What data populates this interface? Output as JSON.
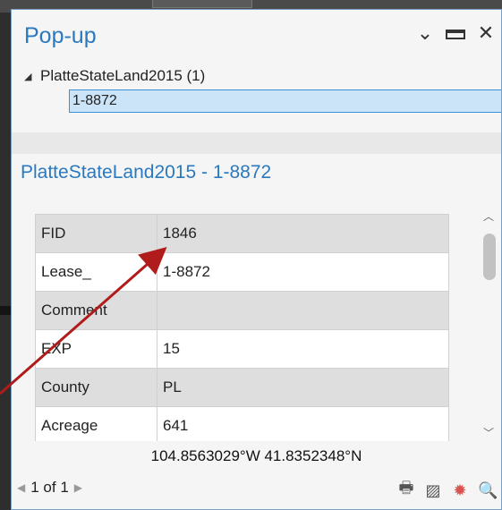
{
  "window": {
    "title": "Pop-up",
    "dropdown_icon": "⌄",
    "maximize_icon": "maximize-icon",
    "close_icon": "✕"
  },
  "tree": {
    "layer_label": "PlatteStateLand2015 (1)",
    "selected_feature": "1-8872"
  },
  "section": {
    "title": "PlatteStateLand2015 - 1-8872"
  },
  "attributes": [
    {
      "field": "FID",
      "value": "1846"
    },
    {
      "field": "Lease_",
      "value": "1-8872"
    },
    {
      "field": "Comment",
      "value": ""
    },
    {
      "field": "EXP",
      "value": "15"
    },
    {
      "field": "County",
      "value": "PL"
    },
    {
      "field": "Acreage",
      "value": "641"
    }
  ],
  "footer": {
    "coordinates": "104.8563029°W 41.8352348°N",
    "page_indicator": "1 of 1"
  },
  "colors": {
    "accent": "#2a79be",
    "selection_bg": "#cce4f7",
    "arrow": "#b01c1c"
  }
}
